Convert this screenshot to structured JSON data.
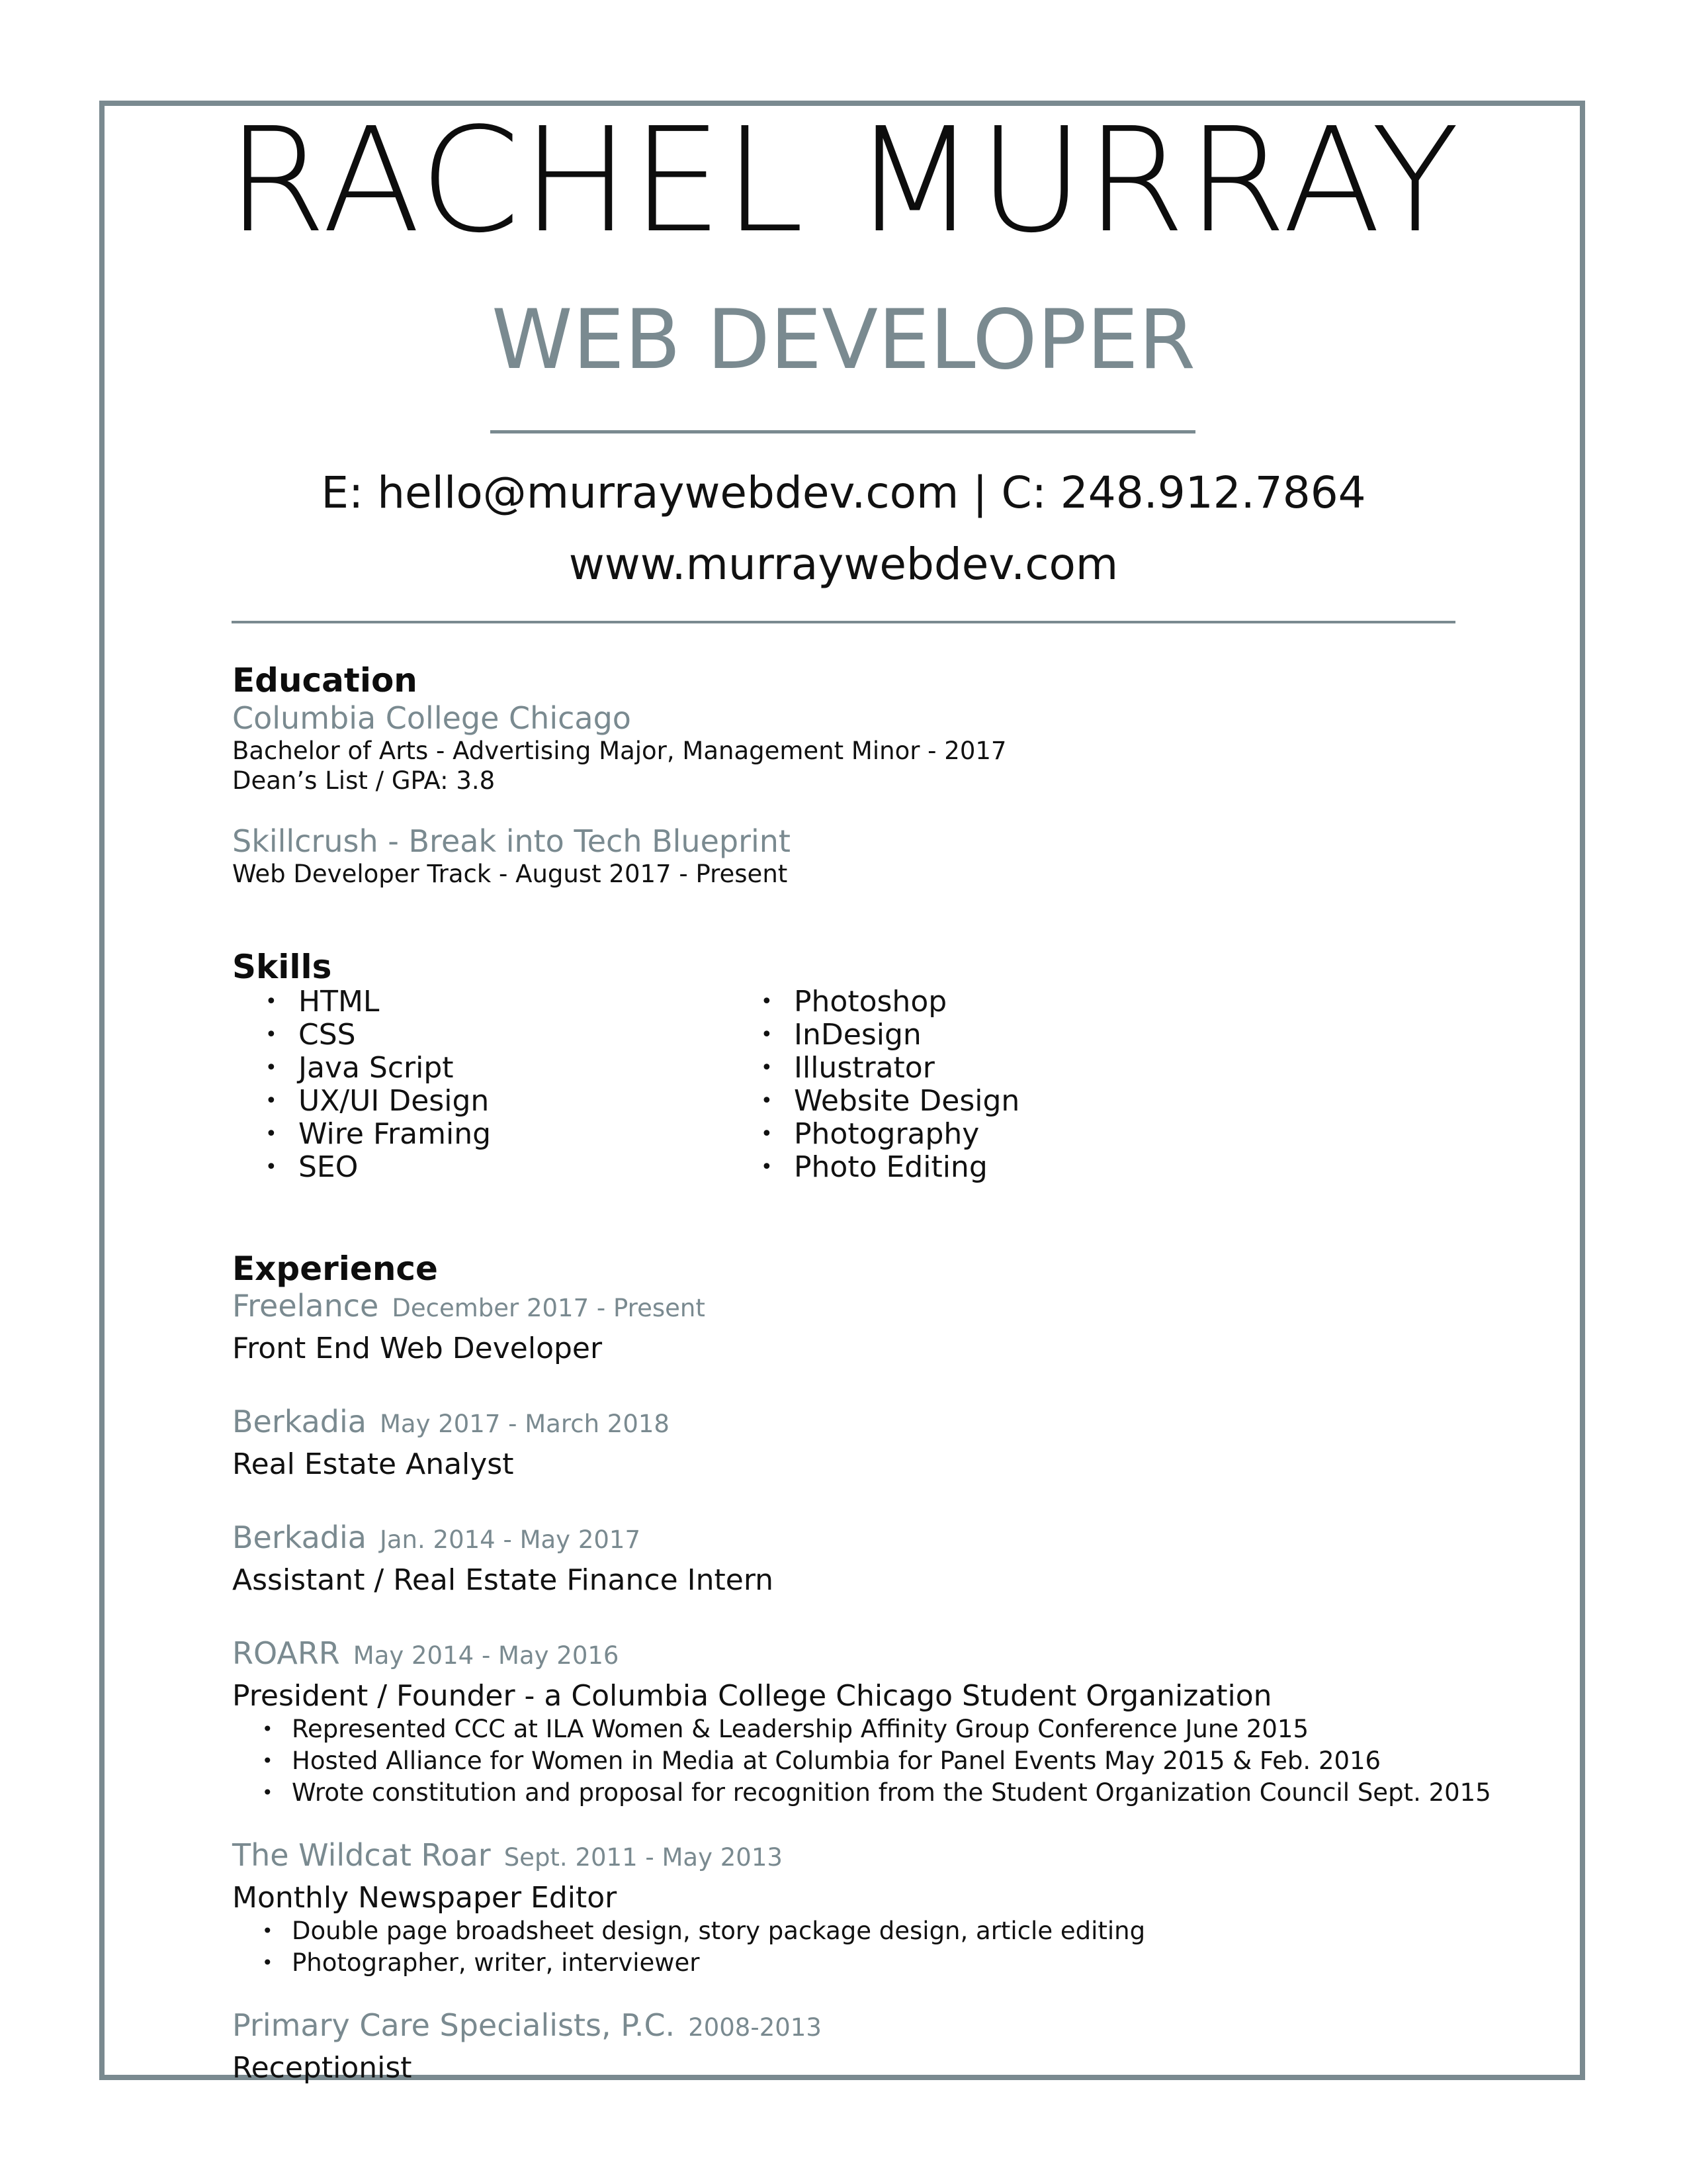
{
  "header": {
    "name": "RACHEL MURRAY",
    "title": "WEB DEVELOPER",
    "contact": "E: hello@murraywebdev.com | C: 248.912.7864",
    "website": "www.murraywebdev.com"
  },
  "colors": {
    "accent": "#7a8a90",
    "text": "#111111"
  },
  "education": {
    "heading": "Education",
    "entries": [
      {
        "school": "Columbia College Chicago",
        "lines": [
          "Bachelor of Arts - Advertising Major, Management Minor - 2017",
          "Dean’s List / GPA: 3.8"
        ]
      },
      {
        "school": "Skillcrush - Break into Tech Blueprint",
        "lines": [
          "Web Developer Track - August 2017 - Present"
        ]
      }
    ]
  },
  "skills": {
    "heading": "Skills",
    "bullet": "•",
    "left": [
      "HTML",
      "CSS",
      "Java Script",
      "UX/UI Design",
      "Wire Framing",
      "SEO"
    ],
    "right": [
      "Photoshop",
      "InDesign",
      "Illustrator",
      "Website Design",
      "Photography",
      "Photo Editing"
    ]
  },
  "experience": {
    "heading": "Experience",
    "entries": [
      {
        "company": "Freelance",
        "dates": "December 2017 - Present",
        "role": "Front End Web Developer",
        "bullets": []
      },
      {
        "company": "Berkadia",
        "dates": "May 2017 - March 2018",
        "role": "Real Estate Analyst",
        "bullets": []
      },
      {
        "company": "Berkadia",
        "dates": "Jan. 2014 - May 2017",
        "role": "Assistant / Real Estate Finance Intern",
        "bullets": []
      },
      {
        "company": "ROARR",
        "dates": "May 2014 - May 2016",
        "role": "President / Founder - a Columbia College Chicago Student Organization",
        "bullets": [
          "Represented CCC at ILA Women & Leadership Affinity Group Conference June 2015",
          "Hosted Alliance for Women in Media at Columbia for Panel Events May 2015 & Feb. 2016",
          "Wrote constitution and proposal for recognition from the Student Organization Council Sept. 2015"
        ]
      },
      {
        "company": "The Wildcat Roar",
        "dates": "Sept. 2011 - May 2013",
        "role": "Monthly Newspaper Editor",
        "bullets": [
          "Double page broadsheet design, story package design, article editing",
          "Photographer, writer, interviewer"
        ]
      },
      {
        "company": "Primary Care Specialists, P.C.",
        "dates": "2008-2013",
        "role": "Receptionist",
        "bullets": []
      }
    ]
  }
}
